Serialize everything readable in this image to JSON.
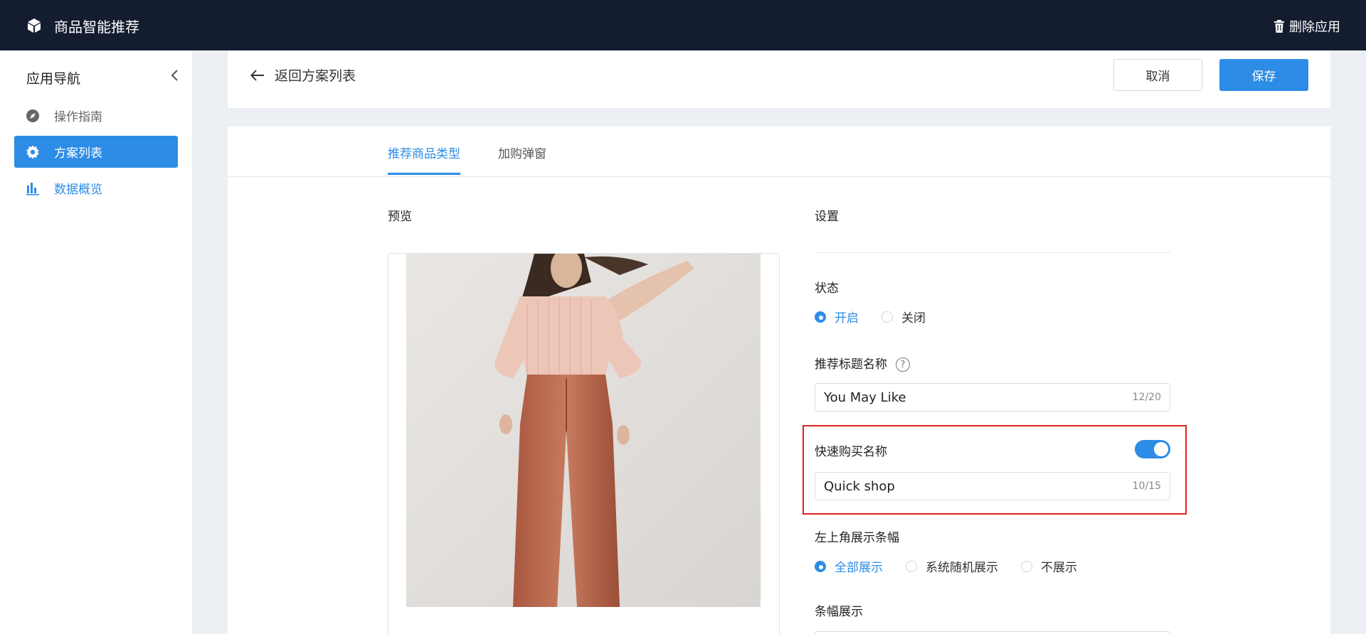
{
  "app": {
    "title": "商品智能推荐",
    "delete_label": "删除应用"
  },
  "sidebar": {
    "title": "应用导航",
    "items": [
      {
        "label": "操作指南",
        "icon": "compass-icon"
      },
      {
        "label": "方案列表",
        "icon": "gear-icon",
        "active": true
      },
      {
        "label": "数据概览",
        "icon": "bar-chart-icon"
      }
    ]
  },
  "header": {
    "back_label": "返回方案列表",
    "cancel_label": "取消",
    "save_label": "保存"
  },
  "tabs": [
    {
      "label": "推荐商品类型",
      "active": true
    },
    {
      "label": "加购弹窗",
      "active": false
    }
  ],
  "preview": {
    "label": "预览"
  },
  "settings": {
    "label": "设置",
    "status": {
      "label": "状态",
      "options": [
        "开启",
        "关闭"
      ],
      "selected": "开启"
    },
    "recommend_title": {
      "label": "推荐标题名称",
      "value": "You May Like",
      "count": "12/20"
    },
    "quick_buy": {
      "label": "快速购买名称",
      "enabled": true,
      "value": "Quick shop",
      "count": "10/15"
    },
    "corner_banner": {
      "label": "左上角展示条幅",
      "options": [
        "全部展示",
        "系统随机展示",
        "不展示"
      ],
      "selected": "全部展示"
    },
    "banner_display": {
      "label": "条幅展示"
    }
  },
  "colors": {
    "topbar": "#141c30",
    "accent": "#2d8ce6",
    "highlight": "#e02020"
  }
}
